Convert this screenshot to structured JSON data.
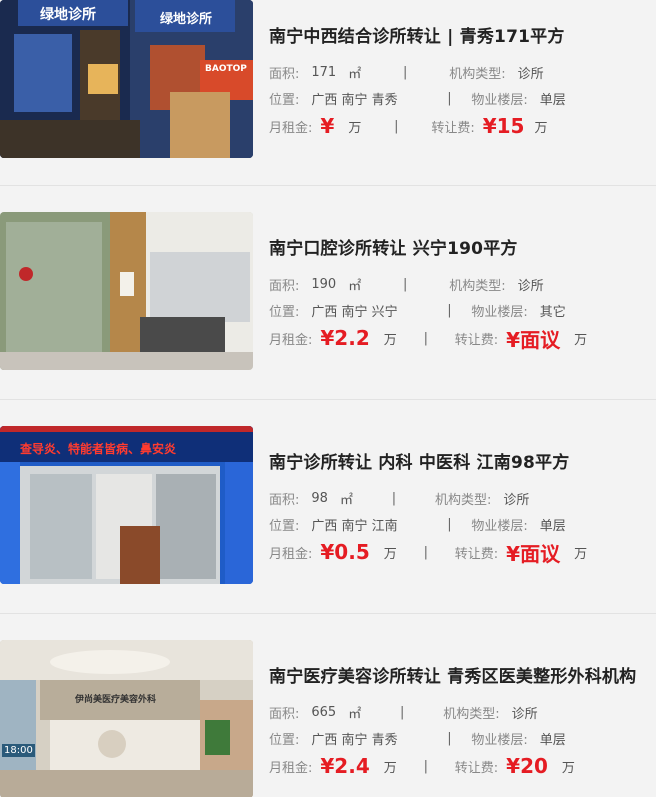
{
  "listings": [
    {
      "title": "南宁中西结合诊所转让 | 青秀171平方",
      "area_label": "面积:",
      "area_value": "171",
      "area_unit": "㎡",
      "type_label": "机构类型:",
      "type_value": "诊所",
      "location_label": "位置:",
      "location_value": "广西 南宁 青秀",
      "floor_label": "物业楼层:",
      "floor_value": "单层",
      "rent_label": "月租金:",
      "rent_value": "¥",
      "rent_unit": "万",
      "fee_label": "转让费:",
      "fee_value": "¥15",
      "fee_unit": "万",
      "sign_text_1": "绿地诊所",
      "sign_text_2": "绿地诊所",
      "sign_text_3": "BAOTOP"
    },
    {
      "title": "南宁口腔诊所转让 兴宁190平方",
      "area_label": "面积:",
      "area_value": "190",
      "area_unit": "㎡",
      "type_label": "机构类型:",
      "type_value": "诊所",
      "location_label": "位置:",
      "location_value": "广西 南宁 兴宁",
      "floor_label": "物业楼层:",
      "floor_value": "其它",
      "rent_label": "月租金:",
      "rent_value": "¥2.2",
      "rent_unit": "万",
      "fee_label": "转让费:",
      "fee_value": "¥面议",
      "fee_unit": "万"
    },
    {
      "title": "南宁诊所转让 内科 中医科 江南98平方",
      "area_label": "面积:",
      "area_value": "98",
      "area_unit": "㎡",
      "type_label": "机构类型:",
      "type_value": "诊所",
      "location_label": "位置:",
      "location_value": "广西 南宁 江南",
      "floor_label": "物业楼层:",
      "floor_value": "单层",
      "rent_label": "月租金:",
      "rent_value": "¥0.5",
      "rent_unit": "万",
      "fee_label": "转让费:",
      "fee_value": "¥面议",
      "fee_unit": "万",
      "sign_text_1": "查导炎、特能者皆病、鼻安炎"
    },
    {
      "title": "南宁医疗美容诊所转让 青秀区医美整形外科机构",
      "area_label": "面积:",
      "area_value": "665",
      "area_unit": "㎡",
      "type_label": "机构类型:",
      "type_value": "诊所",
      "location_label": "位置:",
      "location_value": "广西 南宁 青秀",
      "floor_label": "物业楼层:",
      "floor_value": "单层",
      "rent_label": "月租金:",
      "rent_value": "¥2.4",
      "rent_unit": "万",
      "fee_label": "转让费:",
      "fee_value": "¥20",
      "fee_unit": "万",
      "sign_text_1": "伊尚美医疗美容外科",
      "sign_text_2": "18:00"
    }
  ],
  "colors": {
    "price": "#e51c23",
    "background": "#f3f3f3",
    "divider": "#e2e2e2"
  }
}
